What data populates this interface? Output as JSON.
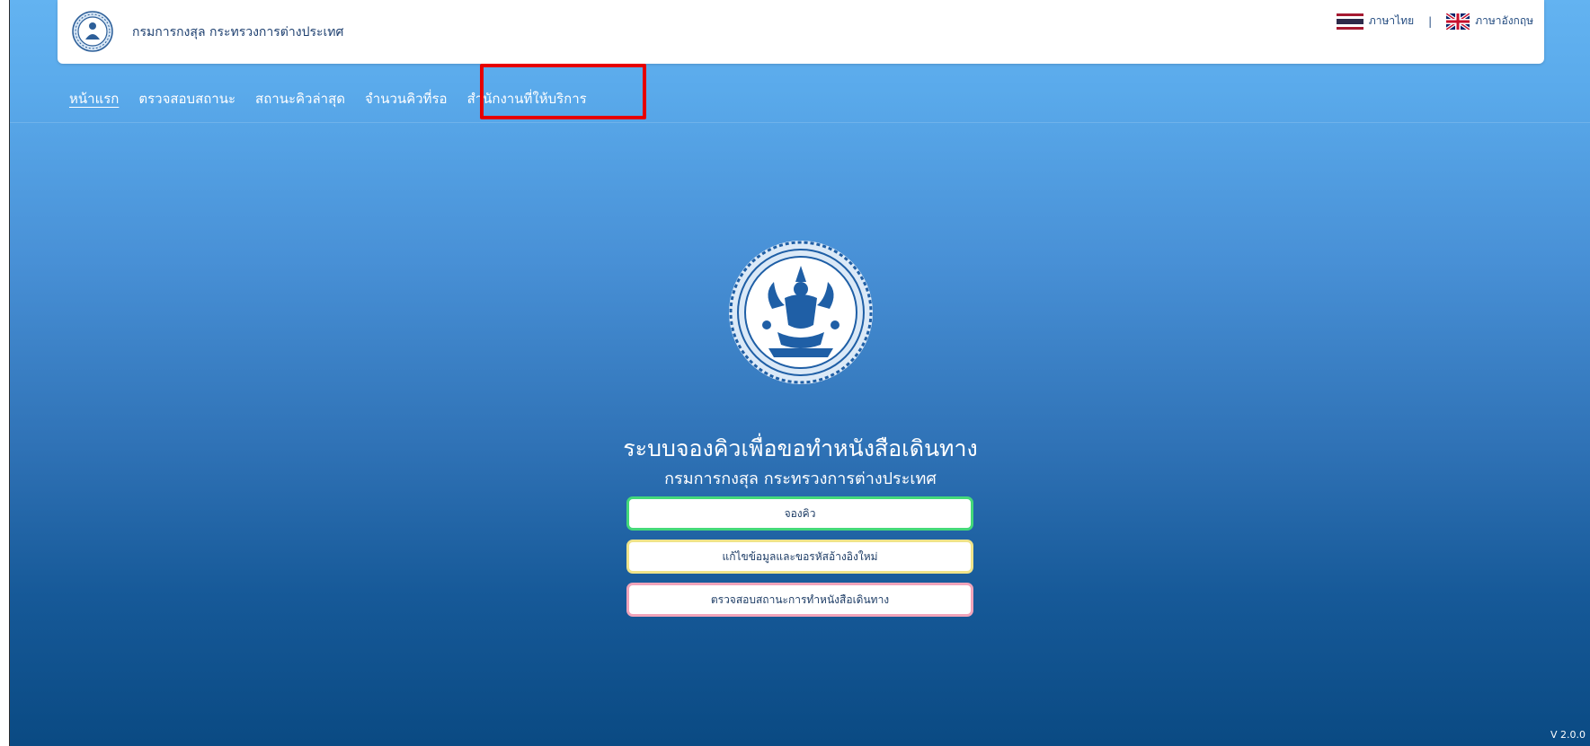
{
  "header": {
    "org_title": "กรมการกงสุล กระทรวงการต่างประเทศ",
    "languages": {
      "thai": "ภาษาไทย",
      "separator": "|",
      "english": "ภาษาอังกฤษ"
    }
  },
  "nav": {
    "items": [
      {
        "label": "หน้าแรก"
      },
      {
        "label": "ตรวจสอบสถานะ"
      },
      {
        "label": "สถานะคิวล่าสุด"
      },
      {
        "label": "จำนวนคิวที่รอ"
      },
      {
        "label": "สำนักงานที่ให้บริการ"
      }
    ]
  },
  "hero": {
    "title": "ระบบจองคิวเพื่อขอทำหนังสือเดินทาง",
    "subtitle": "กรมการกงสุล กระทรวงการต่างประเทศ"
  },
  "actions": {
    "book": "จองคิว",
    "edit": "แก้ไขข้อมูลและขอรหัสอ้างอิงใหม่",
    "check": "ตรวจสอบสถานะการทำหนังสือเดินทาง"
  },
  "footer": {
    "version": "V 2.0.0"
  },
  "colors": {
    "highlight": "#e60000",
    "book_border": "#44d97a",
    "edit_border": "#efe38a",
    "check_border": "#f1a4ba"
  },
  "icons": {
    "seal": "department-seal-icon",
    "thai_flag": "thai-flag-icon",
    "uk_flag": "uk-flag-icon"
  }
}
